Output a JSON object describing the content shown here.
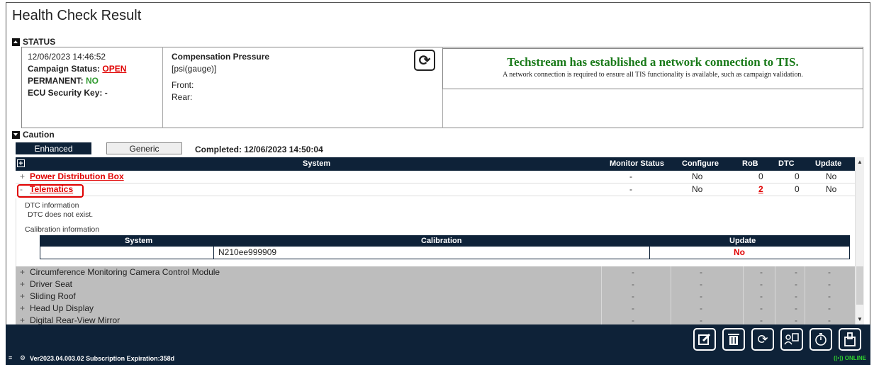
{
  "title": "Health Check Result",
  "status_section": {
    "label": "STATUS"
  },
  "status": {
    "datetime": "12/06/2023 14:46:52",
    "campaign_label": "Campaign Status: ",
    "campaign_value": "OPEN",
    "permanent_label": "PERMANENT: ",
    "permanent_value": "NO",
    "ecu_key": "ECU Security Key: -",
    "comp_pressure": "Compensation Pressure",
    "comp_unit": "[psi(gauge)]",
    "front": "Front:",
    "rear": "Rear:"
  },
  "tis": {
    "title": "Techstream has established a network connection to TIS.",
    "subtitle": "A network connection is required to ensure all TIS functionality is available, such as campaign validation."
  },
  "caution_section": {
    "label": "Caution"
  },
  "tabs": [
    {
      "label": "Enhanced"
    },
    {
      "label": "Generic"
    }
  ],
  "completed": "Completed: 12/06/2023 14:50:04",
  "grid": {
    "headers": {
      "system": "System",
      "monitor": "Monitor Status",
      "configure": "Configure",
      "rob": "RoB",
      "dtc": "DTC",
      "update": "Update"
    },
    "rows": [
      {
        "expander": "+",
        "name": "Power Distribution Box",
        "monitor": "-",
        "configure": "No",
        "rob": "0",
        "dtc": "0",
        "update": "No"
      },
      {
        "expander": "-",
        "name": "Telematics",
        "monitor": "-",
        "configure": "No",
        "rob": "2",
        "dtc": "0",
        "update": "No"
      }
    ],
    "detail": {
      "dtc_title": "DTC information",
      "dtc_text": "DTC does not exist.",
      "cal_title": "Calibration information",
      "cal_headers": {
        "system": "System",
        "calibration": "Calibration",
        "update": "Update"
      },
      "cal_row": {
        "system": "",
        "calibration": "N210ee999909",
        "update": "No"
      }
    },
    "gray_rows": [
      {
        "expander": "+",
        "name": "Circumference Monitoring Camera Control Module",
        "monitor": "-",
        "configure": "-",
        "rob": "-",
        "dtc": "-",
        "update": "-"
      },
      {
        "expander": "+",
        "name": "Driver Seat",
        "monitor": "-",
        "configure": "-",
        "rob": "-",
        "dtc": "-",
        "update": "-"
      },
      {
        "expander": "+",
        "name": "Sliding Roof",
        "monitor": "-",
        "configure": "-",
        "rob": "-",
        "dtc": "-",
        "update": "-"
      },
      {
        "expander": "+",
        "name": "Head Up Display",
        "monitor": "-",
        "configure": "-",
        "rob": "-",
        "dtc": "-",
        "update": "-"
      },
      {
        "expander": "+",
        "name": "Digital Rear-View Mirror",
        "monitor": "-",
        "configure": "-",
        "rob": "-",
        "dtc": "-",
        "update": "-"
      }
    ]
  },
  "toolbar": {
    "buttons": [
      {
        "icon": "edit-icon"
      },
      {
        "icon": "trash-icon"
      },
      {
        "icon": "refresh-icon"
      },
      {
        "icon": "user-document-icon"
      },
      {
        "icon": "timer-icon"
      },
      {
        "icon": "connector-icon"
      }
    ]
  },
  "statusbar": {
    "version": "Ver2023.04.003.02  Subscription Expiration:358d",
    "online": "ONLINE"
  },
  "colors": {
    "navy": "#0e2238",
    "red": "#e00000",
    "green": "#2e9a2e",
    "tis_green": "#1a7a1a"
  }
}
